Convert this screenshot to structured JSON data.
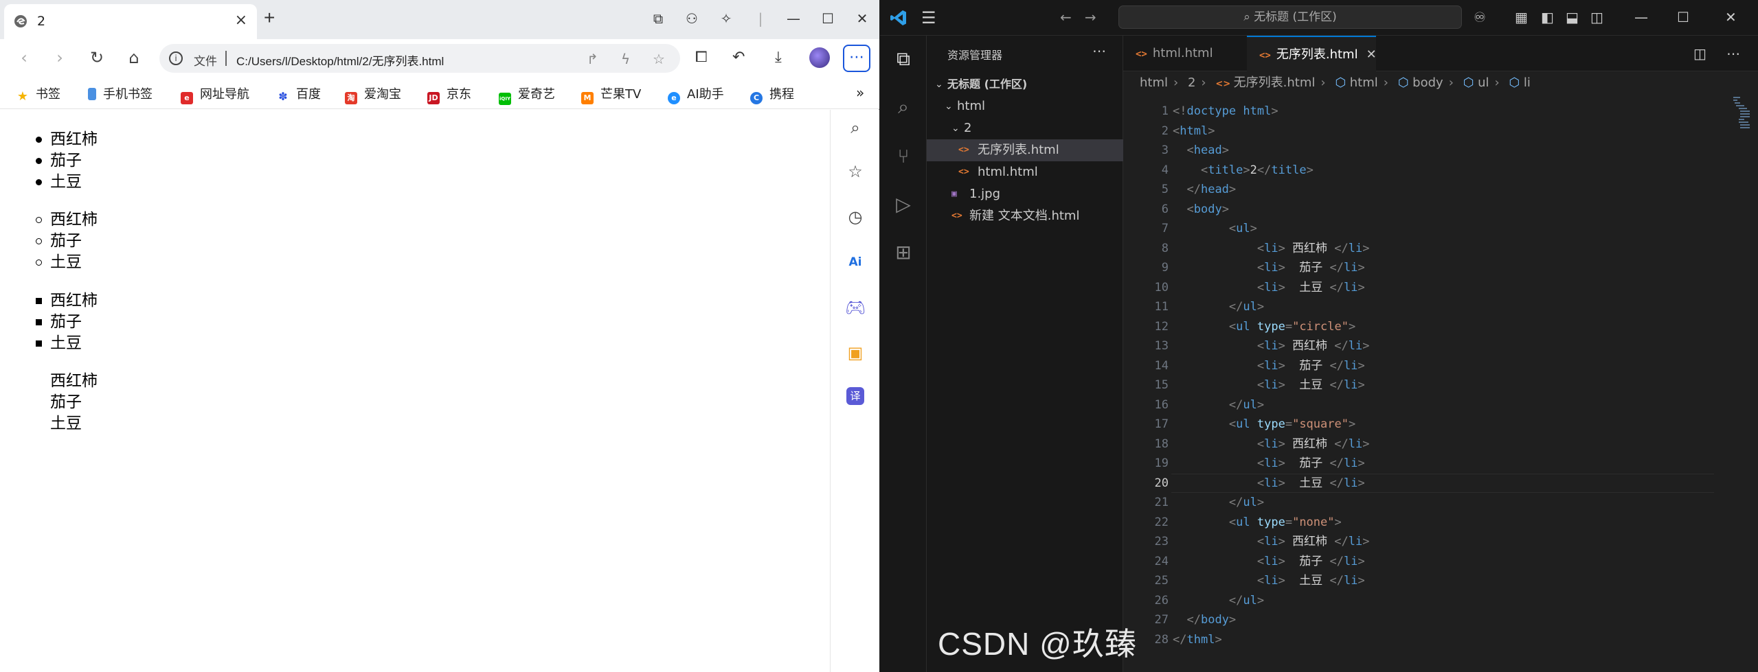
{
  "browser": {
    "tab_title": "2",
    "omnibox_label": "文件",
    "url": "C:/Users/l/Desktop/html/2/无序列表.html",
    "bookmarks": [
      "书签",
      "手机书签",
      "网址导航",
      "百度",
      "爱淘宝",
      "京东",
      "爱奇艺",
      "芒果TV",
      "AI助手",
      "携程"
    ],
    "bookmark_icon_text": {
      "jd": "JD",
      "iqiyi": "iQIY"
    },
    "lists": [
      {
        "type": "disc",
        "items": [
          "西红柿",
          "茄子",
          "土豆"
        ]
      },
      {
        "type": "circle",
        "items": [
          "西红柿",
          "茄子",
          "土豆"
        ]
      },
      {
        "type": "square",
        "items": [
          "西红柿",
          "茄子",
          "土豆"
        ]
      },
      {
        "type": "none",
        "items": [
          "西红柿",
          "茄子",
          "土豆"
        ]
      }
    ]
  },
  "vscode": {
    "command_center": "无标题 (工作区)",
    "explorer_title": "资源管理器",
    "workspace": "无标题 (工作区)",
    "tree": [
      {
        "label": "html",
        "kind": "folder"
      },
      {
        "label": "2",
        "kind": "folder"
      },
      {
        "label": "无序列表.html",
        "kind": "html",
        "selected": true
      },
      {
        "label": "html.html",
        "kind": "html"
      },
      {
        "label": "1.jpg",
        "kind": "jpg"
      },
      {
        "label": "新建 文本文档.html",
        "kind": "html"
      }
    ],
    "tabs": [
      {
        "label": "html.html",
        "active": false
      },
      {
        "label": "无序列表.html",
        "active": true
      }
    ],
    "breadcrumb": [
      "html",
      "2",
      "无序列表.html",
      "html",
      "body",
      "ul",
      "li"
    ],
    "current_line": 20,
    "code_lines": [
      "<!doctype html>",
      "<html>",
      "  <head>",
      "    <title>2</title>",
      "  </head>",
      "  <body>",
      "        <ul>",
      "            <li> 西红柿 </li>",
      "            <li>  茄子 </li>",
      "            <li>  土豆 </li>",
      "        </ul>",
      "        <ul type=\"circle\">",
      "            <li> 西红柿 </li>",
      "            <li>  茄子 </li>",
      "            <li>  土豆 </li>",
      "        </ul>",
      "        <ul type=\"square\">",
      "            <li> 西红柿 </li>",
      "            <li>  茄子 </li>",
      "            <li>  土豆 </li>",
      "        </ul>",
      "        <ul type=\"none\">",
      "            <li> 西红柿 </li>",
      "            <li>  茄子 </li>",
      "            <li>  土豆 </li>",
      "        </ul>",
      "  </body>",
      "</thml>"
    ]
  },
  "watermark": "CSDN @玖臻",
  "colors": {
    "vs_accent": "#0078d4",
    "html_icon": "#e37933",
    "tag": "#569cd6",
    "attr": "#9cdcfe",
    "string": "#ce9178"
  }
}
